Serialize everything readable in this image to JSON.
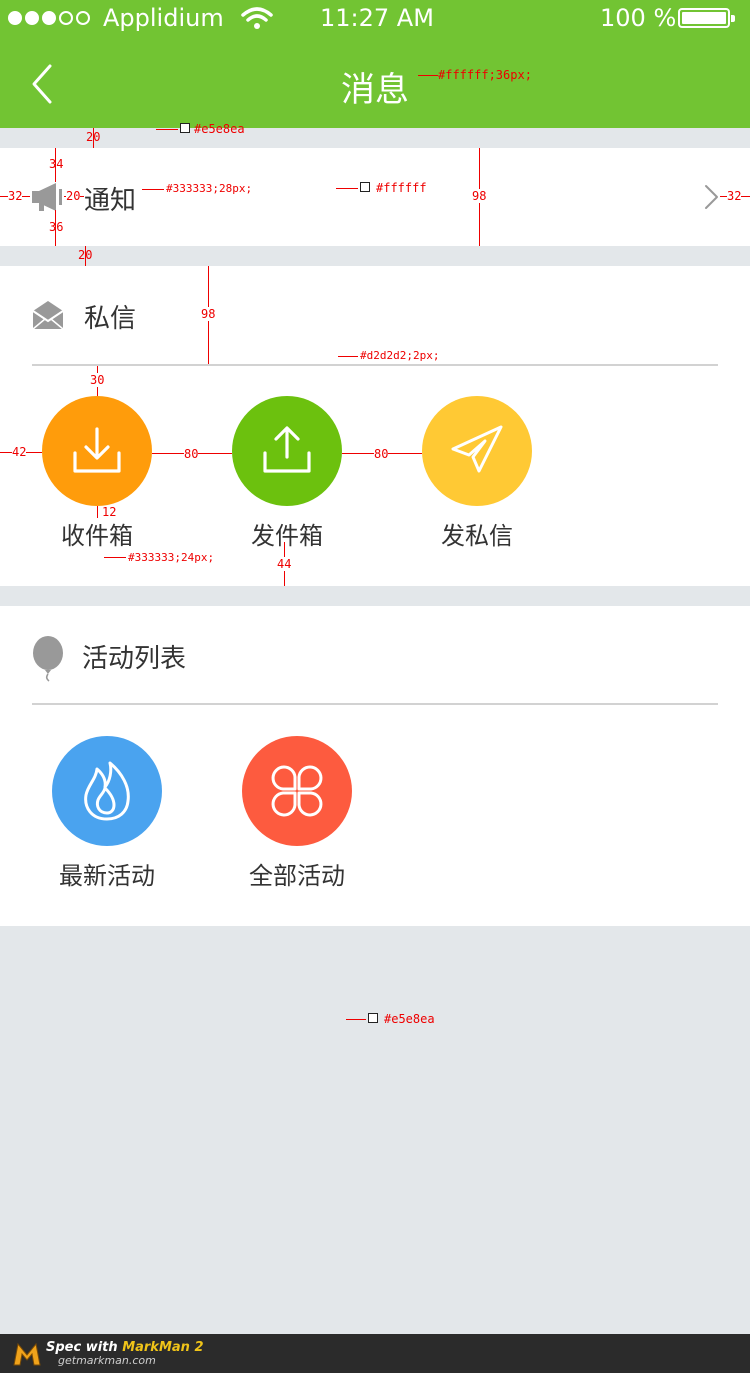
{
  "status_bar": {
    "carrier": "Applidium",
    "time": "11:27 AM",
    "battery": "100 %"
  },
  "header": {
    "title": "消息"
  },
  "notification": {
    "label": "通知"
  },
  "private_message": {
    "label": "私信",
    "actions": [
      {
        "label": "收件箱",
        "icon": "download-icon",
        "color": "#ff9c0b"
      },
      {
        "label": "发件箱",
        "icon": "upload-icon",
        "color": "#6cc10e"
      },
      {
        "label": "发私信",
        "icon": "paper-plane-icon",
        "color": "#ffc934"
      }
    ]
  },
  "activities": {
    "label": "活动列表",
    "actions": [
      {
        "label": "最新活动",
        "icon": "flame-icon",
        "color": "#4aa3ef"
      },
      {
        "label": "全部活动",
        "icon": "clover-icon",
        "color": "#fd5b3f"
      }
    ]
  },
  "annotations": {
    "title_style": "#ffffff;36px;",
    "bg_color_1": "#e5e8ea",
    "label_style": "#333333;28px;",
    "white_color": "#ffffff",
    "divider_style": "#d2d2d2;2px;",
    "caption_style": "#333333;24px;",
    "bg_color_2": "#e5e8ea",
    "m20a": "20",
    "m34": "34",
    "m32a": "32",
    "m20b": "20",
    "m36": "36",
    "m98a": "98",
    "m32b": "32",
    "m20c": "20",
    "m98b": "98",
    "m30": "30",
    "m42": "42",
    "m80a": "80",
    "m80b": "80",
    "m12": "12",
    "m44": "44"
  },
  "footer": {
    "brand_prefix": "Spec with ",
    "brand": "MarkMan 2",
    "url": "getmarkman.com"
  }
}
